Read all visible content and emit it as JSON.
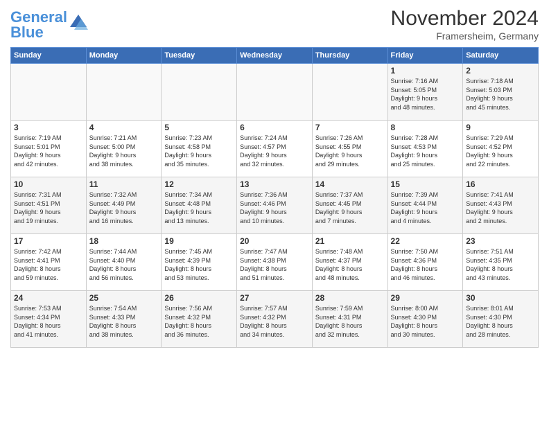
{
  "header": {
    "logo_general": "General",
    "logo_blue": "Blue",
    "month_title": "November 2024",
    "location": "Framersheim, Germany"
  },
  "weekdays": [
    "Sunday",
    "Monday",
    "Tuesday",
    "Wednesday",
    "Thursday",
    "Friday",
    "Saturday"
  ],
  "weeks": [
    [
      {
        "day": "",
        "info": ""
      },
      {
        "day": "",
        "info": ""
      },
      {
        "day": "",
        "info": ""
      },
      {
        "day": "",
        "info": ""
      },
      {
        "day": "",
        "info": ""
      },
      {
        "day": "1",
        "info": "Sunrise: 7:16 AM\nSunset: 5:05 PM\nDaylight: 9 hours\nand 48 minutes."
      },
      {
        "day": "2",
        "info": "Sunrise: 7:18 AM\nSunset: 5:03 PM\nDaylight: 9 hours\nand 45 minutes."
      }
    ],
    [
      {
        "day": "3",
        "info": "Sunrise: 7:19 AM\nSunset: 5:01 PM\nDaylight: 9 hours\nand 42 minutes."
      },
      {
        "day": "4",
        "info": "Sunrise: 7:21 AM\nSunset: 5:00 PM\nDaylight: 9 hours\nand 38 minutes."
      },
      {
        "day": "5",
        "info": "Sunrise: 7:23 AM\nSunset: 4:58 PM\nDaylight: 9 hours\nand 35 minutes."
      },
      {
        "day": "6",
        "info": "Sunrise: 7:24 AM\nSunset: 4:57 PM\nDaylight: 9 hours\nand 32 minutes."
      },
      {
        "day": "7",
        "info": "Sunrise: 7:26 AM\nSunset: 4:55 PM\nDaylight: 9 hours\nand 29 minutes."
      },
      {
        "day": "8",
        "info": "Sunrise: 7:28 AM\nSunset: 4:53 PM\nDaylight: 9 hours\nand 25 minutes."
      },
      {
        "day": "9",
        "info": "Sunrise: 7:29 AM\nSunset: 4:52 PM\nDaylight: 9 hours\nand 22 minutes."
      }
    ],
    [
      {
        "day": "10",
        "info": "Sunrise: 7:31 AM\nSunset: 4:51 PM\nDaylight: 9 hours\nand 19 minutes."
      },
      {
        "day": "11",
        "info": "Sunrise: 7:32 AM\nSunset: 4:49 PM\nDaylight: 9 hours\nand 16 minutes."
      },
      {
        "day": "12",
        "info": "Sunrise: 7:34 AM\nSunset: 4:48 PM\nDaylight: 9 hours\nand 13 minutes."
      },
      {
        "day": "13",
        "info": "Sunrise: 7:36 AM\nSunset: 4:46 PM\nDaylight: 9 hours\nand 10 minutes."
      },
      {
        "day": "14",
        "info": "Sunrise: 7:37 AM\nSunset: 4:45 PM\nDaylight: 9 hours\nand 7 minutes."
      },
      {
        "day": "15",
        "info": "Sunrise: 7:39 AM\nSunset: 4:44 PM\nDaylight: 9 hours\nand 4 minutes."
      },
      {
        "day": "16",
        "info": "Sunrise: 7:41 AM\nSunset: 4:43 PM\nDaylight: 9 hours\nand 2 minutes."
      }
    ],
    [
      {
        "day": "17",
        "info": "Sunrise: 7:42 AM\nSunset: 4:41 PM\nDaylight: 8 hours\nand 59 minutes."
      },
      {
        "day": "18",
        "info": "Sunrise: 7:44 AM\nSunset: 4:40 PM\nDaylight: 8 hours\nand 56 minutes."
      },
      {
        "day": "19",
        "info": "Sunrise: 7:45 AM\nSunset: 4:39 PM\nDaylight: 8 hours\nand 53 minutes."
      },
      {
        "day": "20",
        "info": "Sunrise: 7:47 AM\nSunset: 4:38 PM\nDaylight: 8 hours\nand 51 minutes."
      },
      {
        "day": "21",
        "info": "Sunrise: 7:48 AM\nSunset: 4:37 PM\nDaylight: 8 hours\nand 48 minutes."
      },
      {
        "day": "22",
        "info": "Sunrise: 7:50 AM\nSunset: 4:36 PM\nDaylight: 8 hours\nand 46 minutes."
      },
      {
        "day": "23",
        "info": "Sunrise: 7:51 AM\nSunset: 4:35 PM\nDaylight: 8 hours\nand 43 minutes."
      }
    ],
    [
      {
        "day": "24",
        "info": "Sunrise: 7:53 AM\nSunset: 4:34 PM\nDaylight: 8 hours\nand 41 minutes."
      },
      {
        "day": "25",
        "info": "Sunrise: 7:54 AM\nSunset: 4:33 PM\nDaylight: 8 hours\nand 38 minutes."
      },
      {
        "day": "26",
        "info": "Sunrise: 7:56 AM\nSunset: 4:32 PM\nDaylight: 8 hours\nand 36 minutes."
      },
      {
        "day": "27",
        "info": "Sunrise: 7:57 AM\nSunset: 4:32 PM\nDaylight: 8 hours\nand 34 minutes."
      },
      {
        "day": "28",
        "info": "Sunrise: 7:59 AM\nSunset: 4:31 PM\nDaylight: 8 hours\nand 32 minutes."
      },
      {
        "day": "29",
        "info": "Sunrise: 8:00 AM\nSunset: 4:30 PM\nDaylight: 8 hours\nand 30 minutes."
      },
      {
        "day": "30",
        "info": "Sunrise: 8:01 AM\nSunset: 4:30 PM\nDaylight: 8 hours\nand 28 minutes."
      }
    ]
  ]
}
